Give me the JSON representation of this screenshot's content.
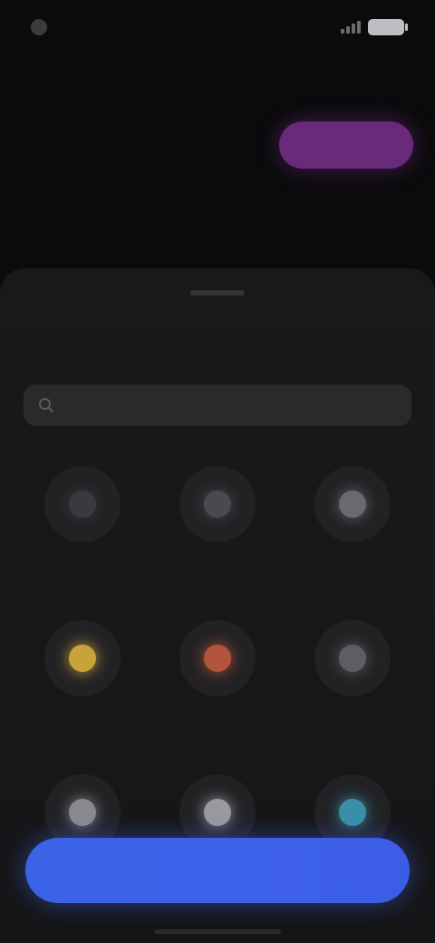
{
  "status_bar": {
    "time": "",
    "battery_color": "#bdbdc2"
  },
  "header": {
    "title": ""
  },
  "tabs": [
    {
      "label": "",
      "active": false
    },
    {
      "label": "",
      "active": false
    },
    {
      "label": "",
      "active": true,
      "color": "#6a2a7a"
    }
  ],
  "sheet": {
    "title": "",
    "search": {
      "placeholder": "",
      "value": ""
    },
    "options": [
      {
        "label": "",
        "icon": "circle-icon",
        "color": "#3a3a3e"
      },
      {
        "label": "",
        "icon": "circle-icon",
        "color": "#4a4a4e"
      },
      {
        "label": "",
        "icon": "circle-icon",
        "color": "#6a6a6e"
      },
      {
        "label": "",
        "icon": "sun-icon",
        "color": "#c9a23a"
      },
      {
        "label": "",
        "icon": "flame-icon",
        "color": "#b5543c"
      },
      {
        "label": "",
        "icon": "circle-icon",
        "color": "#5e5e62"
      },
      {
        "label": "",
        "icon": "circle-icon",
        "color": "#8a8a8e"
      },
      {
        "label": "",
        "icon": "circle-icon",
        "color": "#9a9a9e"
      },
      {
        "label": "",
        "icon": "drop-icon",
        "color": "#3a8fa8"
      }
    ]
  },
  "cta": {
    "label": "",
    "color": "#3f62ea"
  }
}
